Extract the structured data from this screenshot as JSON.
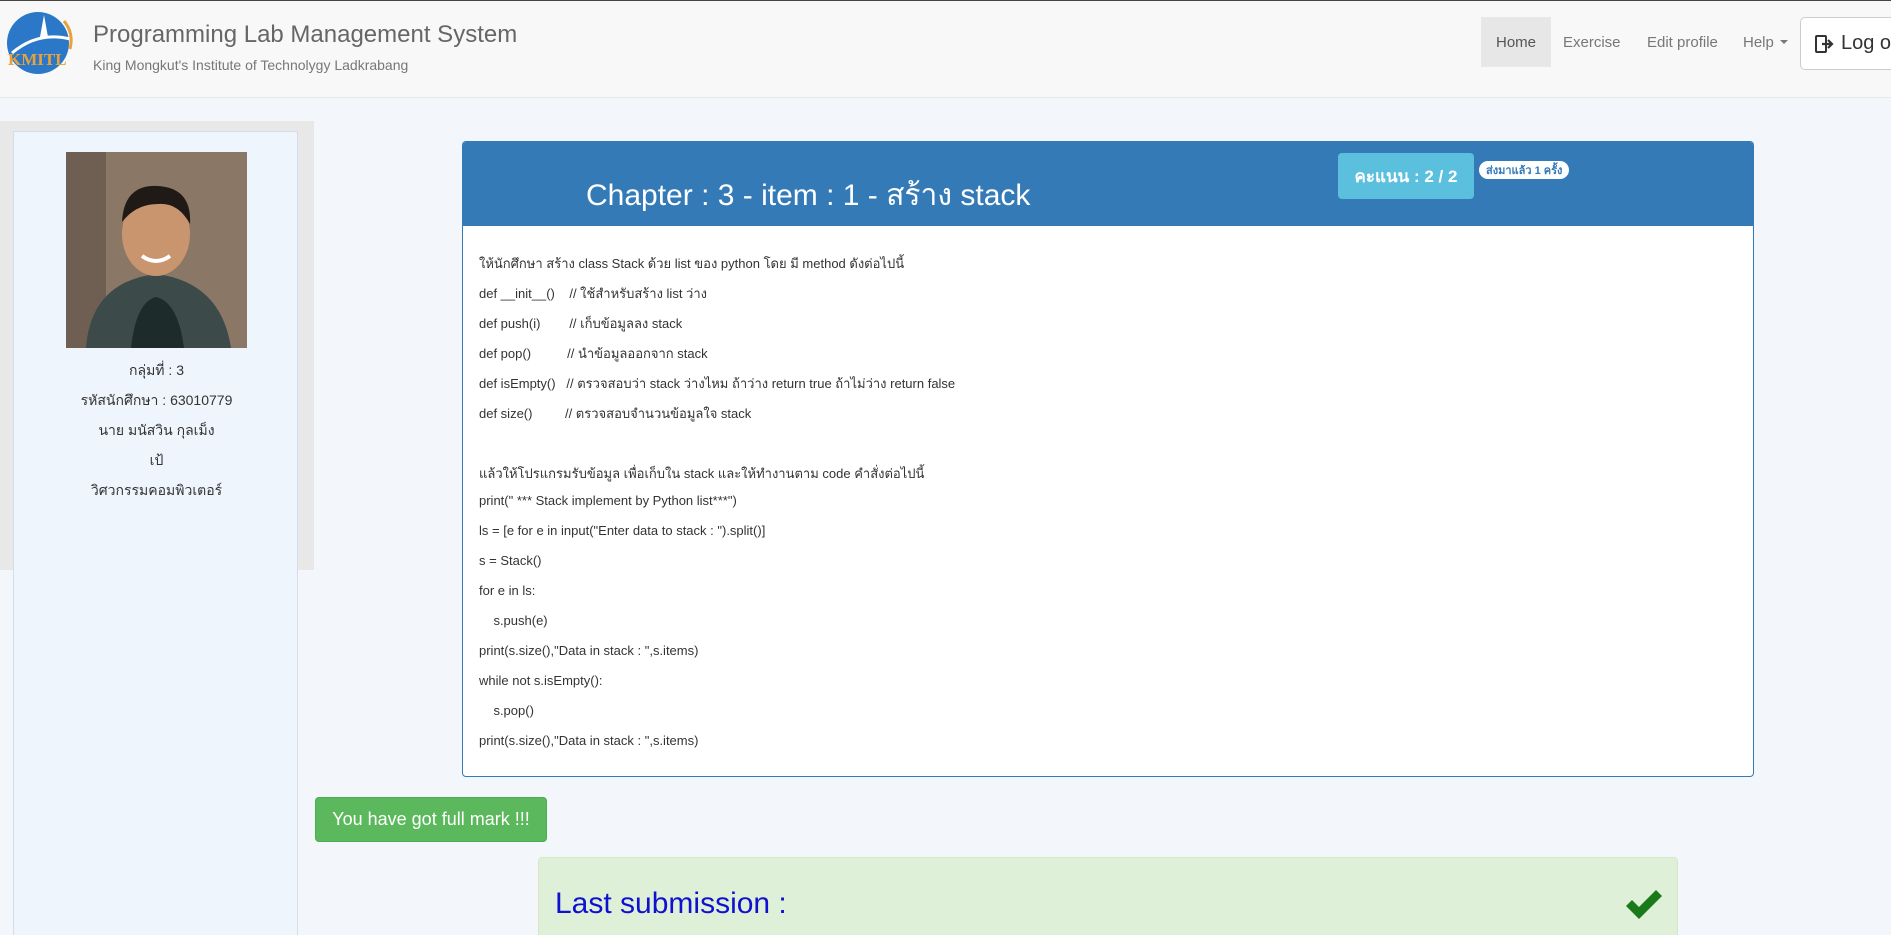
{
  "header": {
    "logo_text": "KMITL",
    "title": "Programming Lab Management System",
    "subtitle": "King Mongkut's Institute of Technolygy Ladkrabang",
    "nav": {
      "home": "Home",
      "exercise": "Exercise",
      "edit_profile": "Edit profile",
      "help": "Help",
      "logout": "Log ou"
    }
  },
  "profile": {
    "group": "กลุ่มที่ : 3",
    "student_id": "รหัสนักศึกษา : 63010779",
    "name": "นาย มนัสวิน กุลเม็ง",
    "nickname": "เป้",
    "faculty": "วิศวกรรมคอมพิวเตอร์"
  },
  "exercise": {
    "title": "Chapter : 3 - item : 1 - สร้าง stack",
    "score": "คะแนน : 2 / 2",
    "sent_badge": "ส่งมาแล้ว 1 ครั้ง",
    "lines": [
      "ให้นักศึกษา สร้าง class Stack ด้วย list ของ python โดย มี method ดังต่อไปนี้",
      "def __init__()    // ใช้สำหรับสร้าง list ว่าง",
      "def push(i)        // เก็บข้อมูลลง stack",
      "def pop()          // นำข้อมูลออกจาก stack",
      "def isEmpty()   // ตรวจสอบว่า stack ว่างไหม ถ้าว่าง return true ถ้าไม่ว่าง return false",
      "def size()         // ตรวจสอบจำนวนข้อมูลใจ stack",
      "",
      "แล้วให้โปรแกรมรับข้อมูล เพื่อเก็บใน stack และให้ทำงานตาม code คำสั่งต่อไปนี้",
      "print(\" *** Stack implement by Python list***\")",
      "ls = [e for e in input(\"Enter data to stack : \").split()]",
      "s = Stack()",
      "for e in ls:",
      "    s.push(e)",
      "print(s.size(),\"Data in stack : \",s.items)",
      "while not s.isEmpty():",
      "    s.pop()",
      "print(s.size(),\"Data in stack : \",s.items)"
    ]
  },
  "result": {
    "full_mark": "You have got full mark !!!",
    "last_submission": "Last submission :"
  },
  "colors": {
    "primary": "#337ab7",
    "info": "#5bc0de",
    "success": "#5cb85c",
    "success_bg": "#dff0d8",
    "check": "#1a7a1a"
  }
}
